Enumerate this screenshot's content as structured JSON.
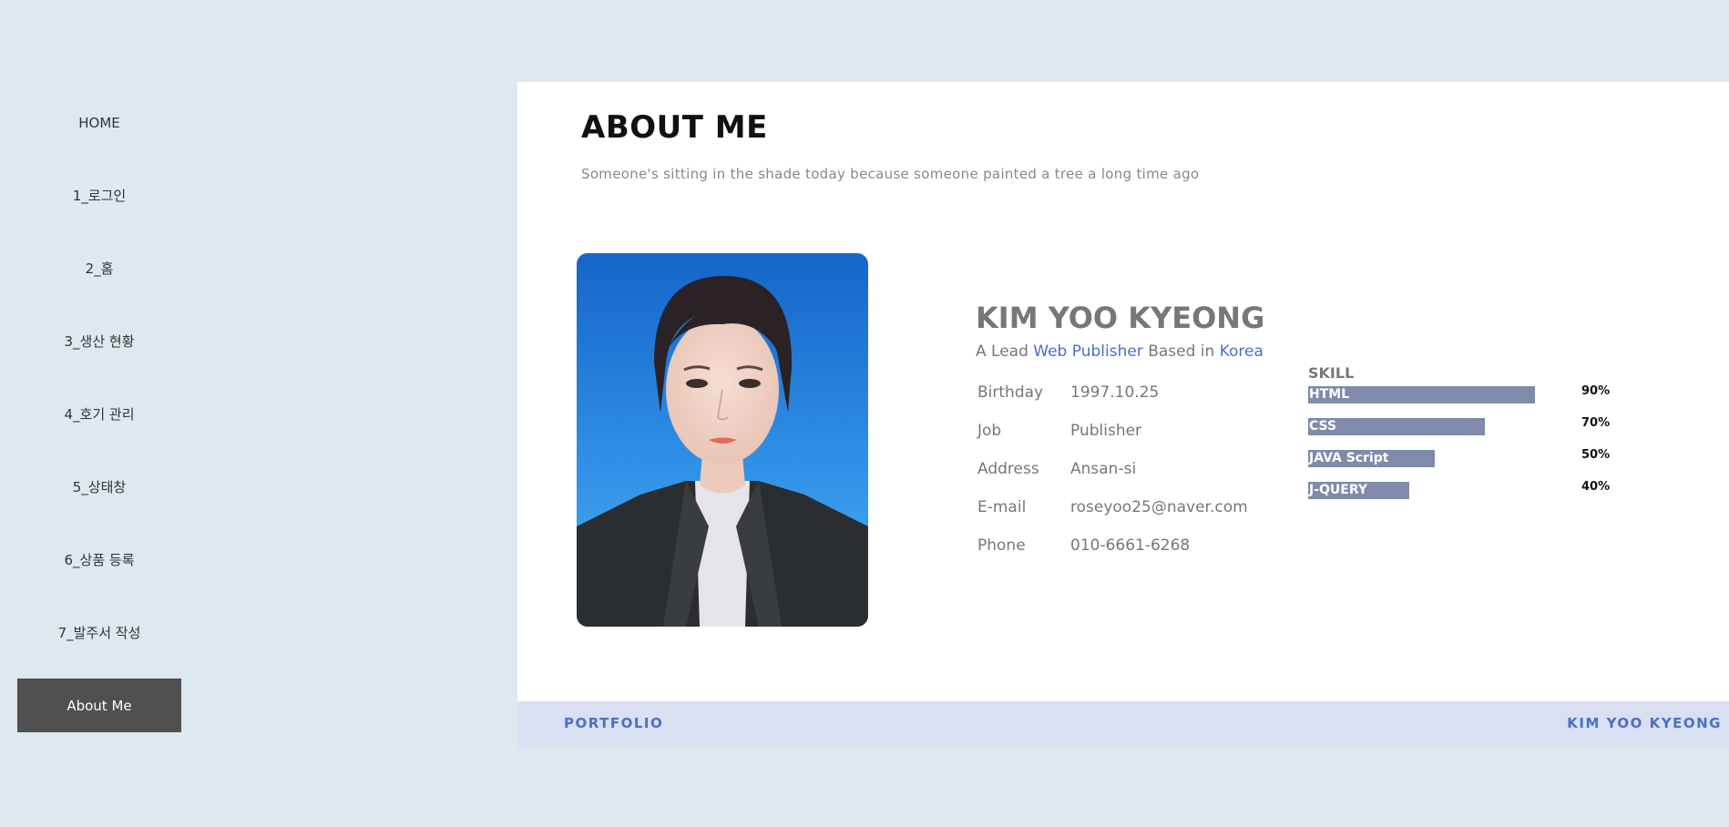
{
  "sidebar": {
    "items": [
      {
        "label": "HOME"
      },
      {
        "label": "1_로그인"
      },
      {
        "label": "2_홈"
      },
      {
        "label": "3_생산 현황"
      },
      {
        "label": "4_호기 관리"
      },
      {
        "label": "5_상태창"
      },
      {
        "label": "6_상품 등록"
      },
      {
        "label": "7_발주서 작성"
      },
      {
        "label": "About Me"
      }
    ],
    "active_index": 8
  },
  "main": {
    "title": "ABOUT ME",
    "subtitle": "Someone's sitting in the shade today because someone painted a tree a long time ago"
  },
  "profile": {
    "name": "KIM YOO KYEONG",
    "tagline": {
      "prefix": "A Lead ",
      "role": "Web Publisher",
      "middle": " Based in ",
      "place": "Korea"
    },
    "info": [
      {
        "label": "Birthday",
        "value": "1997.10.25"
      },
      {
        "label": "Job",
        "value": "Publisher"
      },
      {
        "label": "Address",
        "value": "Ansan-si"
      },
      {
        "label": "E-mail",
        "value": "roseyoo25@naver.com"
      },
      {
        "label": "Phone",
        "value": "010-6661-6268"
      }
    ]
  },
  "skills": {
    "title": "SKILL",
    "items": [
      {
        "name": "HTML",
        "percent_label": "90%",
        "level": 0.9
      },
      {
        "name": "CSS",
        "percent_label": "70%",
        "level": 0.7
      },
      {
        "name": "JAVA Script",
        "percent_label": "50%",
        "level": 0.5
      },
      {
        "name": "J-QUERY",
        "percent_label": "40%",
        "level": 0.4
      }
    ],
    "bar_color": "#7f8ba8"
  },
  "footer": {
    "left": "PORTFOLIO",
    "right": "KIM YOO KYEONG"
  },
  "colors": {
    "background": "#dde8ef",
    "accent": "#4b6fc4",
    "nav_active": "#505050"
  }
}
